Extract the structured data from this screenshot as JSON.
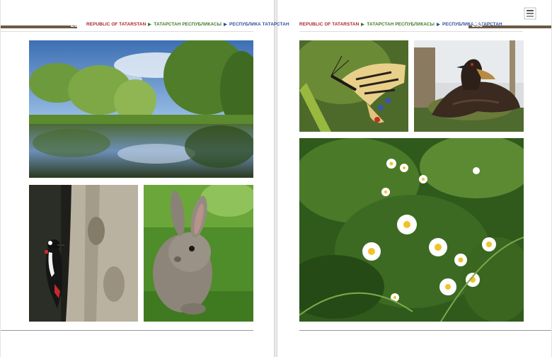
{
  "left_page": {
    "page_number": "252",
    "header": {
      "en": "REPUBLIC OF TATARSTAN",
      "tt": "ТАТАРСТАН РЕСПУБЛИКАСЫ",
      "ru": "РЕСПУБЛИКА ТАТАРСТАН"
    },
    "photos": [
      {
        "subject": "forest-lake-reflection"
      },
      {
        "subject": "woodpecker-on-tree"
      },
      {
        "subject": "hare-in-grass"
      }
    ]
  },
  "right_page": {
    "page_number": "253",
    "header": {
      "en": "REPUBLIC OF TATARSTAN",
      "tt": "ТАТАРСТАН РЕСПУБЛИКАСЫ",
      "ru": "РЕСПУБЛИКА ТАТАРСТАН"
    },
    "photos": [
      {
        "subject": "swallowtail-butterfly"
      },
      {
        "subject": "grebe-on-nest"
      },
      {
        "subject": "chamomile-meadow"
      }
    ]
  },
  "colors": {
    "header_bar": "#6b5a45",
    "header_red": "#a8252a",
    "header_green": "#3c7a2c",
    "header_blue": "#2e4d9a"
  }
}
